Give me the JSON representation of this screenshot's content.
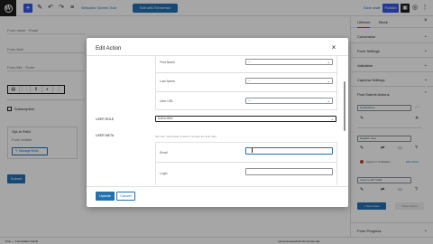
{
  "topbar": {
    "add_icon": "plus-icon",
    "link_1": "Welcome Screen Tour",
    "pill_label": "Edit with Elementor",
    "save_draft": "Save draft",
    "publish": "Publish"
  },
  "editor": {
    "field_1_label": "Form name",
    "field_1_value": "Email",
    "field_2_label": "Form field",
    "field_3_label": "Form title",
    "field_3_value": "Order",
    "checkbox_label": "Subscription",
    "group_label": "Opt-in Field",
    "group_hint": "Form builder",
    "manage_label": "Manage fields",
    "submit_label": "Submit"
  },
  "sidebar": {
    "tab_1": "Lifeform",
    "tab_2": "Block",
    "sections": [
      "Conversion",
      "Form Settings",
      "Validation",
      "Captcha Settings",
      "Post Submit Actions"
    ],
    "actions_select": "Notifications",
    "register_select": "Register User",
    "apply_link": "Apply for verification",
    "edit_link": "Edit Action",
    "user_select": "Insert to WP CRM",
    "new_action": "+ New Action",
    "clear_btn": "Clear Actions",
    "progress_label": "Form Progress"
  },
  "statusbar": {
    "crumbs": "Post → Consultation Fields",
    "notice": "Last autosave/draft 10 minutes ago"
  },
  "modal": {
    "title": "Edit Action",
    "rows": [
      {
        "label": "First Name",
        "value": "---"
      },
      {
        "label": "Last Name",
        "value": "---"
      },
      {
        "label": "User URL",
        "value": "---"
      }
    ],
    "user_role_label": "USER ROLE",
    "user_role_value": "Subscriber",
    "user_meta_label": "USER META",
    "user_meta_desc": "Set user meta fields to add or change the field data",
    "meta_rows": [
      {
        "label": "Email"
      },
      {
        "label": "Login"
      }
    ],
    "update": "Update",
    "cancel": "Cancel"
  }
}
